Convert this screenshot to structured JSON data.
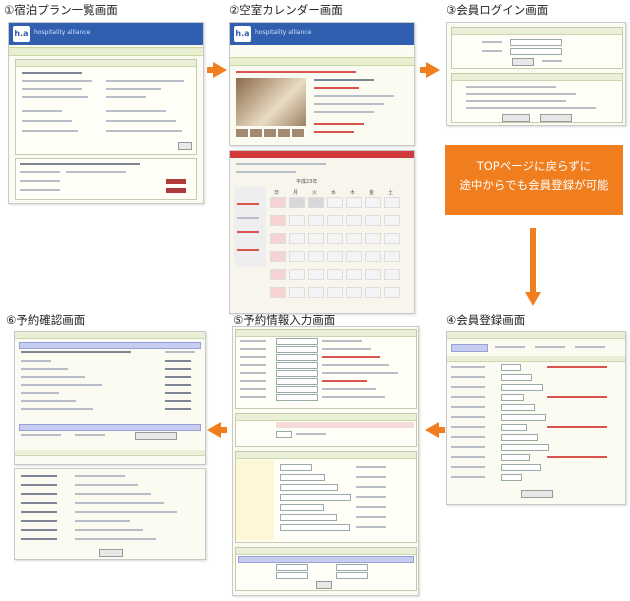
{
  "steps": [
    {
      "title": "①宿泊プラン一覧画面"
    },
    {
      "title": "②空室カレンダー画面"
    },
    {
      "title": "③会員ログイン画面"
    },
    {
      "title": "④会員登録画面"
    },
    {
      "title": "⑤予約情報入力画面"
    },
    {
      "title": "⑥予約確認画面"
    }
  ],
  "note": {
    "line1": "TOPページに戻らずに",
    "line2": "途中からでも会員登録が可能"
  },
  "mock": {
    "logo": "h.a",
    "header_text": "hospitality alliance",
    "calendar_month": "平成23年",
    "weekdays": [
      "日",
      "月",
      "火",
      "水",
      "木",
      "金",
      "土"
    ],
    "colors": {
      "arrow": "#f07d1e",
      "header_blue": "#2f5fae",
      "nav_green": "#e8efd0",
      "calendar_red": "#d03a3a"
    }
  }
}
